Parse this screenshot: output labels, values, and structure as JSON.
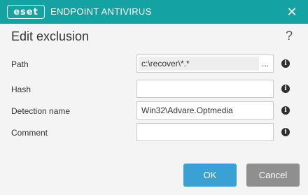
{
  "titlebar": {
    "logo_text": "eset",
    "product_name": "ENDPOINT ANTIVIRUS",
    "close_glyph": "✕",
    "accent_color": "#14a3a2"
  },
  "header": {
    "title": "Edit exclusion",
    "help_glyph": "?"
  },
  "form": {
    "path": {
      "label": "Path",
      "value": "c:\\recover\\*.*",
      "browse_label": "..."
    },
    "hash": {
      "label": "Hash",
      "value": ""
    },
    "detection_name": {
      "label": "Detection name",
      "value": "Win32\\Advare.Optmedia"
    },
    "comment": {
      "label": "Comment",
      "value": ""
    },
    "info_glyph": "i"
  },
  "buttons": {
    "ok_label": "OK",
    "cancel_label": "Cancel",
    "ok_color": "#3aa1d4",
    "cancel_color": "#8f8f8f"
  }
}
